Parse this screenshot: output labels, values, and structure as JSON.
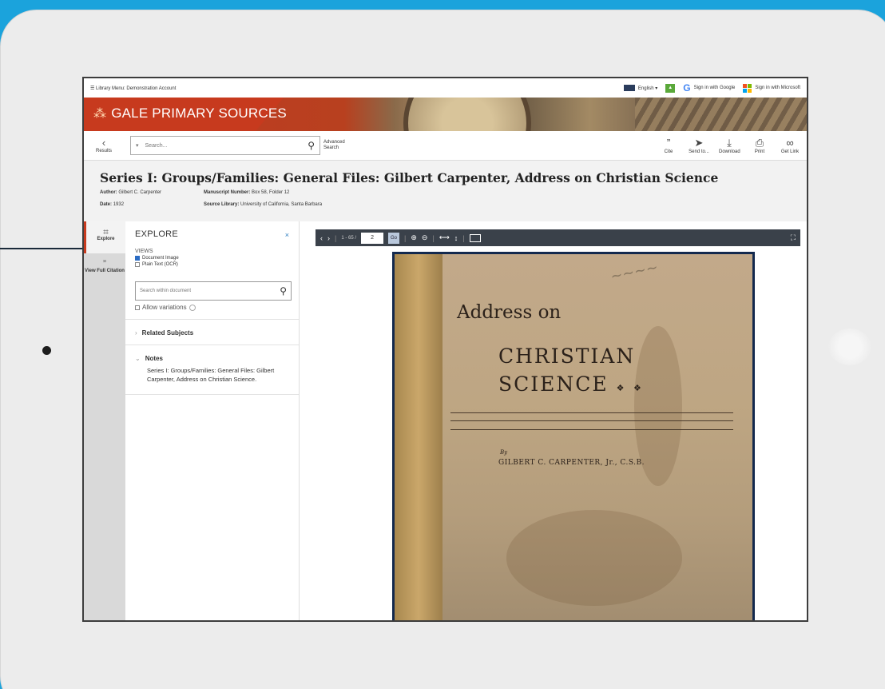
{
  "topbar": {
    "menu": "☰ Library Menu: Demonstration Account",
    "language": "English ▾",
    "signin_google": "Sign in with Google",
    "signin_microsoft": "Sign in with Microsoft"
  },
  "banner": {
    "brand": "GALE PRIMARY SOURCES"
  },
  "toolbar": {
    "back_label": "Results",
    "search_scope": "▾",
    "search_placeholder": "Search...",
    "advanced": "Advanced Search",
    "tools": [
      {
        "label": "Cite",
        "icon": "”"
      },
      {
        "label": "Send to...",
        "icon": "➤"
      },
      {
        "label": "Download",
        "icon": "⤓"
      },
      {
        "label": "Print",
        "icon": "⎙"
      },
      {
        "label": "Get Link",
        "icon": "∞"
      }
    ]
  },
  "document": {
    "title": "Series I: Groups/Families: General Files: Gilbert Carpenter, Address on Christian Science",
    "author_label": "Author:",
    "author": "Gilbert C. Carpenter",
    "manuscript_label": "Manuscript Number:",
    "manuscript": "Box 58, Folder 12",
    "date_label": "Date:",
    "date": "1932",
    "source_label": "Source Library:",
    "source": "University of California, Santa Barbara"
  },
  "rail": {
    "explore": "Explore",
    "citation": "View Full Citation"
  },
  "explore": {
    "heading": "EXPLORE",
    "close": "×",
    "views_label": "VIEWS",
    "view_image": "Document Image",
    "view_ocr": "Plain Text (OCR)",
    "search_placeholder": "Search within document",
    "allow_variations": "Allow variations",
    "related": "Related Subjects",
    "notes_label": "Notes",
    "notes_text": "Series I: Groups/Families: General Files: Gilbert Carpenter, Address on Christian Science."
  },
  "viewer": {
    "page_range": "1 - 65 /",
    "page_value": "2",
    "go": "Go"
  },
  "cover": {
    "line1": "Address on",
    "line2": "CHRISTIAN",
    "line3": "SCIENCE",
    "ornament": "❖ ❖",
    "by": "By",
    "author": "GILBERT C. CARPENTER, Jr., C.S.B."
  }
}
